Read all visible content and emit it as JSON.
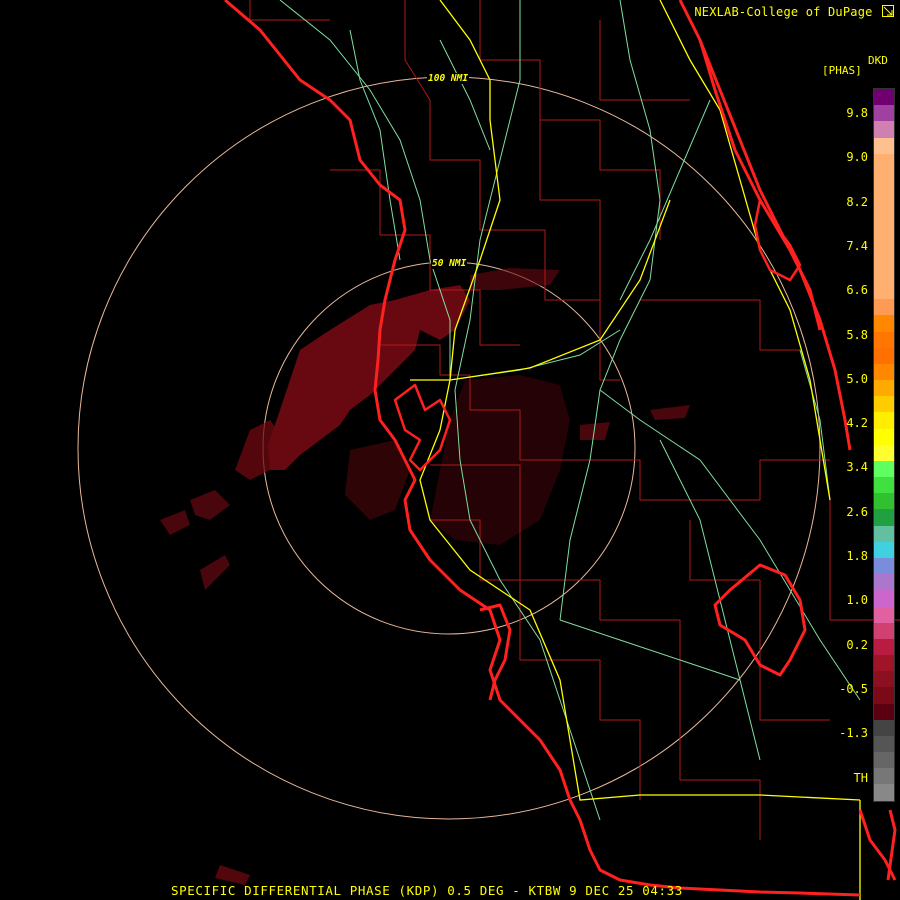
{
  "header": {
    "credit": "NEXLAB-College of DuPage",
    "credit_icon": "diagonal-arrow-icon"
  },
  "footer": {
    "product_line": "SPECIFIC DIFFERENTIAL PHASE (KDP) 0.5 DEG - KTBW 9 DEC 25 04:33"
  },
  "legend": {
    "unit_line1": "DKD",
    "unit_line2": "[PHAS]",
    "ticks": [
      "9.8",
      "9.0",
      "8.2",
      "7.4",
      "6.6",
      "5.8",
      "5.0",
      "4.2",
      "3.4",
      "2.6",
      "1.8",
      "1.0",
      "0.2",
      "-0.5",
      "-1.3",
      "TH"
    ],
    "colors": [
      "#c04a84",
      "#1a1a1a",
      "#888",
      "#777",
      "#666",
      "#555",
      "#444",
      "#5a0010",
      "#7a0a18",
      "#8b1020",
      "#a01428",
      "#b81c40",
      "#d04070",
      "#e060a0",
      "#cc66cc",
      "#aa77cc",
      "#7a8cdc",
      "#40d0e0",
      "#20a040",
      "#30c030",
      "#40e040",
      "#60ff60",
      "#ffff00",
      "#ffee00",
      "#ffcc00",
      "#ff9900",
      "#ff8800",
      "#ff7700",
      "#ff6a1a",
      "#ff9a55",
      "#ffb070",
      "#ffc090",
      "#d080b0",
      "#a040a0",
      "#700070"
    ],
    "bottom_color": "#d0a0c0"
  },
  "range_rings": [
    {
      "label": "100 NMI"
    },
    {
      "label": "50 NMI"
    }
  ],
  "colors": {
    "coast": "#ff2020",
    "county": "#b01818",
    "highway": "#ffff00",
    "road": "#7fdf9f",
    "ring": "#e8b89a",
    "echo": "#7a0a14"
  }
}
